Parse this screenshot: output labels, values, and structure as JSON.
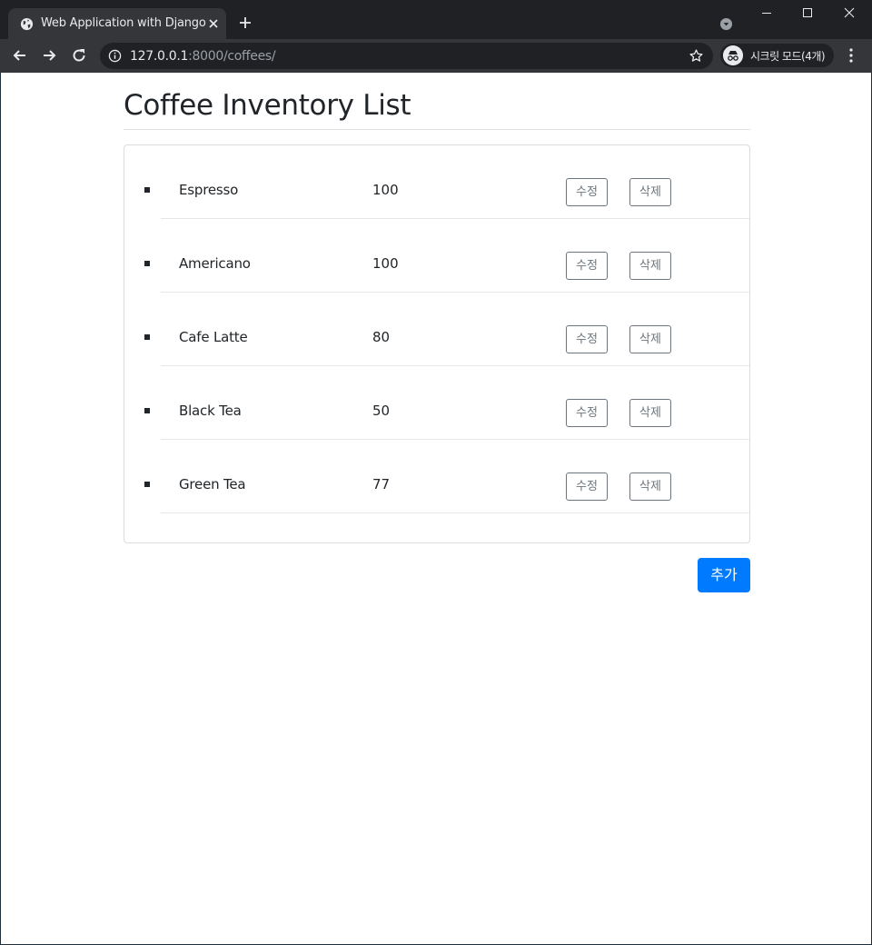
{
  "browser": {
    "tab_title": "Web Application with Django",
    "url_host": "127.0.0.1",
    "url_path": ":8000/coffees/",
    "profile_label": "시크릿 모드(4개)",
    "icons": {
      "favicon": "globe-icon",
      "tab_close": "close-icon",
      "new_tab": "plus-icon",
      "tab_search": "chevron-down-circle-icon",
      "back": "arrow-left-icon",
      "forward": "arrow-right-icon",
      "reload": "reload-icon",
      "site_info": "info-icon",
      "bookmark": "star-icon",
      "profile": "incognito-icon",
      "menu": "kebab-menu-icon"
    }
  },
  "page": {
    "title": "Coffee Inventory List",
    "items": [
      {
        "name": "Espresso",
        "quantity": "100",
        "edit_label": "수정",
        "delete_label": "삭제"
      },
      {
        "name": "Americano",
        "quantity": "100",
        "edit_label": "수정",
        "delete_label": "삭제"
      },
      {
        "name": "Cafe Latte",
        "quantity": "80",
        "edit_label": "수정",
        "delete_label": "삭제"
      },
      {
        "name": "Black Tea",
        "quantity": "50",
        "edit_label": "수정",
        "delete_label": "삭제"
      },
      {
        "name": "Green Tea",
        "quantity": "77",
        "edit_label": "수정",
        "delete_label": "삭제"
      }
    ],
    "add_label": "추가",
    "colors": {
      "primary": "#007bff",
      "secondary": "#6c757d",
      "text": "#212529"
    }
  }
}
